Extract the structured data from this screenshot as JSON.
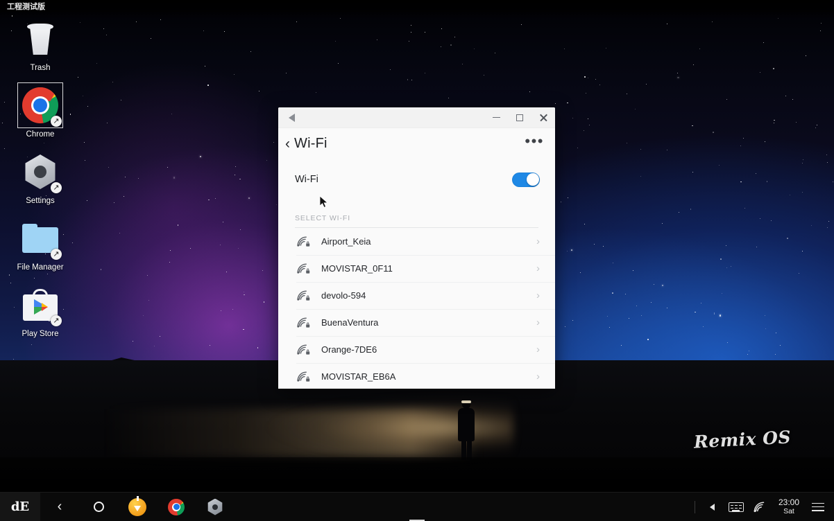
{
  "desktop": {
    "watermark": "工程测试版",
    "brand_watermark": "Remix OS",
    "icons": [
      {
        "label": "Trash",
        "icon": "trash-icon",
        "selected": false
      },
      {
        "label": "Chrome",
        "icon": "chrome-icon",
        "selected": true
      },
      {
        "label": "Settings",
        "icon": "settings-gear-icon",
        "selected": false
      },
      {
        "label": "File Manager",
        "icon": "folder-icon",
        "selected": false
      },
      {
        "label": "Play Store",
        "icon": "play-store-icon",
        "selected": false
      }
    ]
  },
  "window": {
    "titlebar": {
      "back_icon": "back-triangle-icon",
      "minimize_label": "Minimize",
      "maximize_label": "Maximize",
      "close_label": "Close"
    },
    "header": {
      "back_chevron": "‹",
      "title": "Wi-Fi",
      "overflow": "•••"
    },
    "toggle": {
      "label": "Wi-Fi",
      "state": "on",
      "accent_color": "#1e88e5"
    },
    "section_label": "SELECT WI-FI",
    "networks": [
      {
        "name": "Airport_Keia",
        "secured": true,
        "chevron": "›"
      },
      {
        "name": "MOVISTAR_0F11",
        "secured": true,
        "chevron": "›"
      },
      {
        "name": "devolo-594",
        "secured": true,
        "chevron": "›"
      },
      {
        "name": "BuenaVentura",
        "secured": true,
        "chevron": "›"
      },
      {
        "name": "Orange-7DE6",
        "secured": true,
        "chevron": "›"
      },
      {
        "name": "MOVISTAR_EB6A",
        "secured": true,
        "chevron": "›"
      }
    ]
  },
  "taskbar": {
    "logo": "dE",
    "buttons": [
      {
        "name": "back",
        "icon": "chevron-left-icon"
      },
      {
        "name": "home",
        "icon": "circle-home-icon"
      },
      {
        "name": "downloads",
        "icon": "download-icon"
      },
      {
        "name": "chrome",
        "icon": "chrome-icon"
      },
      {
        "name": "settings",
        "icon": "settings-gear-icon"
      }
    ],
    "tray": {
      "volume_icon": "speaker-icon",
      "keyboard_icon": "keyboard-icon",
      "wifi_icon": "wifi-icon",
      "time": "23:00",
      "day": "Sat",
      "menu_icon": "hamburger-menu-icon"
    }
  }
}
